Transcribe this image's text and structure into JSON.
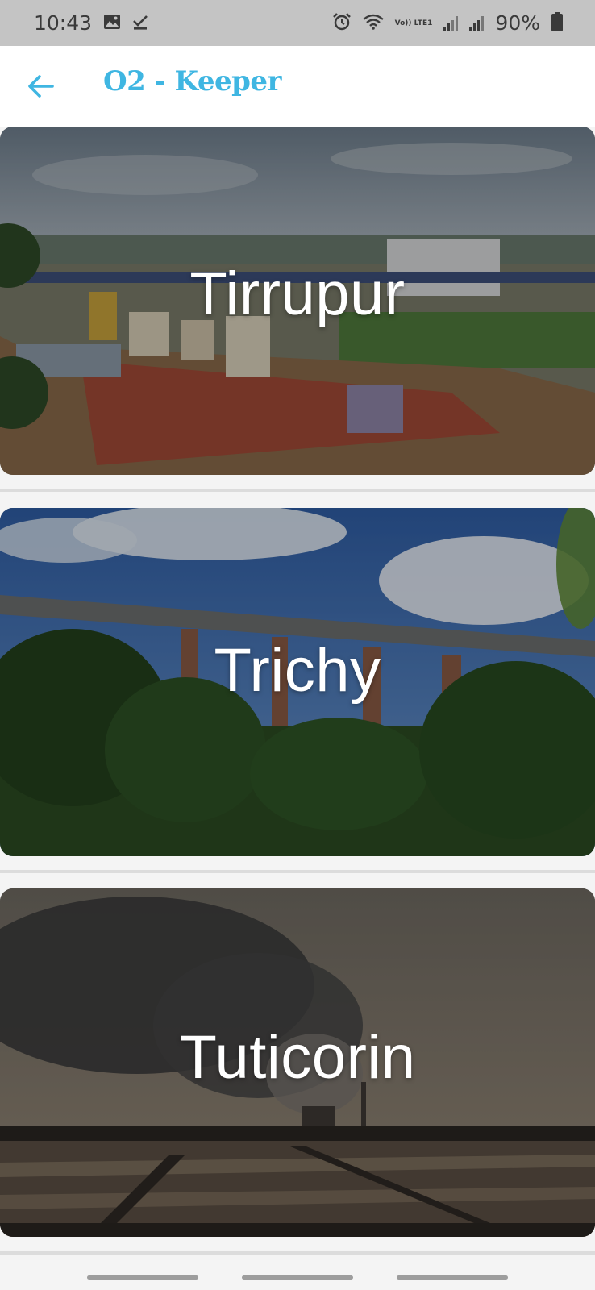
{
  "status_bar": {
    "time": "10:43",
    "battery_percent": "90%",
    "volte_label": "Vo)) LTE1",
    "icons_left": [
      "gallery-icon",
      "download-done-icon"
    ],
    "icons_right": [
      "alarm-icon",
      "wifi-icon",
      "volte-icon",
      "signal-icon",
      "signal-icon",
      "battery-icon"
    ]
  },
  "app_bar": {
    "title": "O2 - Keeper",
    "back_icon": "arrow-left-icon",
    "accent_color": "#3fb6e2"
  },
  "cities": [
    {
      "name": "Tirrupur"
    },
    {
      "name": "Trichy"
    },
    {
      "name": "Tuticorin"
    }
  ],
  "nav_bar": {
    "buttons": [
      "recent-apps",
      "home",
      "back"
    ]
  }
}
